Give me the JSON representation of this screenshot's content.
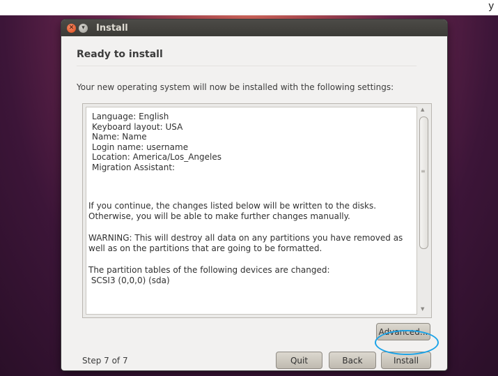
{
  "top_strip_text": "y",
  "window": {
    "title": "Install"
  },
  "heading": "Ready to install",
  "intro": "Your new operating system will now be installed with the following settings:",
  "settings": [
    "Language: English",
    "Keyboard layout: USA",
    "Name: Name",
    "Login name: username",
    "Location: America/Los_Angeles",
    "Migration Assistant:"
  ],
  "paragraphs": [
    "If you continue, the changes listed below will be written to the disks. Otherwise, you will be able to make further changes manually.",
    "WARNING: This will destroy all data on any partitions you have removed as well as on the partitions that are going to be formatted.",
    "The partition tables of the following devices are changed:",
    " SCSI3 (0,0,0) (sda)"
  ],
  "buttons": {
    "advanced": "Advanced...",
    "quit": "Quit",
    "back": "Back",
    "install": "Install"
  },
  "step": "Step 7 of 7",
  "colors": {
    "highlight_ring": "#1aa3e8",
    "close_button": "#df4b16"
  },
  "icons": {
    "close": "close-icon",
    "minimize": "minimize-icon",
    "scroll_up": "arrow-up-icon",
    "scroll_down": "arrow-down-icon"
  }
}
